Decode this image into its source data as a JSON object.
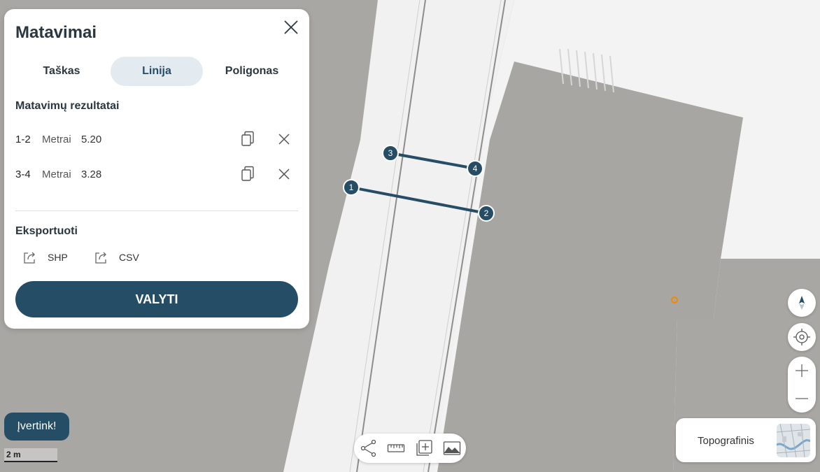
{
  "panel": {
    "title": "Matavimai",
    "tabs": [
      {
        "label": "Taškas",
        "active": false
      },
      {
        "label": "Linija",
        "active": true
      },
      {
        "label": "Poligonas",
        "active": false
      }
    ],
    "results_title": "Matavimų rezultatai",
    "results": [
      {
        "segment": "1-2",
        "unit": "Metrai",
        "value": "5.20"
      },
      {
        "segment": "3-4",
        "unit": "Metrai",
        "value": "3.28"
      }
    ],
    "export_title": "Eksportuoti",
    "export": [
      {
        "label": "SHP",
        "icon": "export-icon"
      },
      {
        "label": "CSV",
        "icon": "export-icon"
      }
    ],
    "clear_label": "VALYTI"
  },
  "feedback_label": "Įvertink!",
  "scale_label": "2 m",
  "basemap_label": "Topografinis",
  "map_points": [
    "1",
    "2",
    "3",
    "4"
  ],
  "toolbar_icons": [
    "share-icon",
    "ruler-icon",
    "add-layer-icon",
    "terrain-icon"
  ],
  "map_controls": [
    "compass-icon",
    "locate-icon",
    "zoom-in-icon",
    "zoom-out-icon"
  ],
  "colors": {
    "accent": "#264d66",
    "tab_active_bg": "#e3ebf0",
    "map_building": "#a9a7a3",
    "map_road": "#f4f4f4",
    "marker_orange": "#f08a00"
  }
}
